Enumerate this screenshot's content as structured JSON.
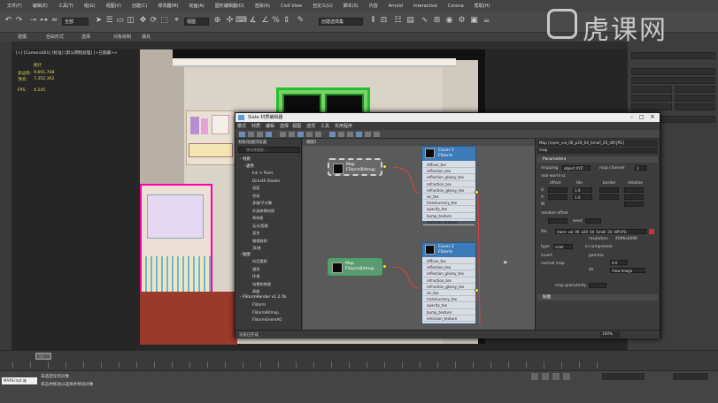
{
  "menubar": [
    "文件(F)",
    "编辑(E)",
    "工具(T)",
    "组(G)",
    "视图(V)",
    "创建(C)",
    "修改器(M)",
    "动画(A)",
    "图形编辑器(D)",
    "渲染(R)",
    "Civil View",
    "自定义(U)",
    "脚本(S)",
    "内容",
    "Arnold",
    "Interactive",
    "Corona",
    "帮助(H)"
  ],
  "toolbar": {
    "selection_filter": "全部",
    "view_dropdown": "视图",
    "selection_set": "创建选择集"
  },
  "subtoolbar": [
    "建模",
    "自由形式",
    "选择",
    "对象绘制",
    "填充"
  ],
  "viewport": {
    "label": "[+] [Camera001] [标准] [默认明暗处理] [+已隐藏>>",
    "stats_title": "统计",
    "stats": [
      {
        "label": "多边形:",
        "value": "9,691,768"
      },
      {
        "label": "顶点:",
        "value": "7,352,362"
      }
    ],
    "fps_label": "FPS:",
    "fps_value": "4.245"
  },
  "slate": {
    "title": "Slate 材质编辑器",
    "menu": [
      "模式",
      "材质",
      "编辑",
      "选择",
      "视图",
      "选项",
      "工具",
      "实用程序"
    ],
    "browser_header": "材质/贴图浏览器",
    "browser_search": "按名称搜索...",
    "sections": {
      "materials": "- 材质",
      "general": "- 通用",
      "maps": "- 贴图",
      "fstorm": "- FStormRender v1.2.7b"
    },
    "materials_items": [
      "Ink 'n Paint",
      "DirectX Shader",
      "双面",
      "合成",
      "多维/子对象",
      "外部参照材质",
      "壳材质",
      "无光/投影",
      "混合",
      "物理材质",
      "顶/底"
    ],
    "maps_items": [
      "向后跟踪",
      "通用",
      "环境",
      "场景和物理",
      "高级"
    ],
    "fstorm_items": [
      "FStorm",
      "FStormBitmap",
      "FStormGeomAO"
    ],
    "view_tab": "视图1",
    "nodes": {
      "map_bitmap_1": {
        "line1": "Map",
        "line2": "FStormBitmap"
      },
      "map_bitmap_2": {
        "line1": "Map",
        "line2": "FStormBitmap"
      },
      "cover1": {
        "line1": "Cover 1",
        "line2": "FStorm"
      },
      "cover2": {
        "line1": "Cover 2",
        "line2": "FStorm"
      },
      "slots": [
        "diffuse_tex",
        "reflection_tex",
        "reflection_glossy_tex",
        "refraction_tex",
        "refraction_glossy_tex",
        "ior_tex",
        "translucency_tex",
        "opacity_tex",
        "bump_texture",
        "emission_texture"
      ]
    },
    "props": {
      "header": "Map [mpre_vol_06_p20_04_Small_20_diff.JPG]",
      "sub": "map",
      "params_title": "Parameters",
      "mapping_label": "mapping",
      "mapping_value": "object XYZ",
      "map_channel_label": "map channel",
      "map_channel_value": "1",
      "real_world_label": "real-world sc",
      "cols": [
        "offset",
        "tile",
        "border",
        "rotation"
      ],
      "u_label": "U",
      "v_label": "V",
      "w_label": "W",
      "tile_val": "1.0",
      "random_offset_label": "random offset",
      "seed_label": "seed",
      "file_label": "file",
      "file_value": "mpre_vol_06_p20_04_Small_20_diff.JPG",
      "resolution_label": "resolution",
      "resolution_value": "4096x4096",
      "type_label": "type",
      "type_value": "color",
      "compressor_label": "in compressor",
      "gamma_label": "gamma",
      "gamma_value": "0.0",
      "inv_label": "invert",
      "normal_map_label": "normal map",
      "strength_label": "str",
      "view_image_label": "View Image",
      "map_granularity_label": "map granularity",
      "rollout": "贴图"
    },
    "status_left": "渲染已完成",
    "status_right": "100%"
  },
  "timeline": {
    "frame": "0 / 100"
  },
  "status": {
    "line1": "未选定任何对象",
    "line2": "单击并拖动以选择并移动对象",
    "mode": "MAXScript 迷"
  },
  "watermark": "虎课网"
}
